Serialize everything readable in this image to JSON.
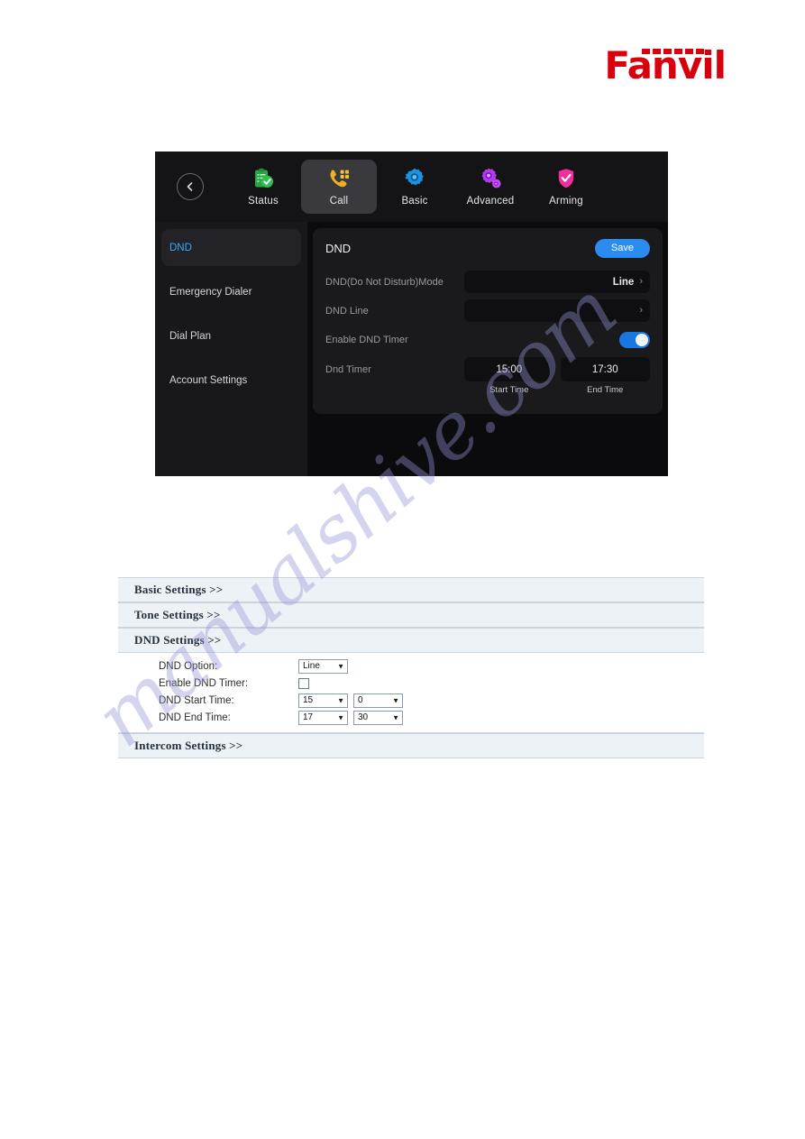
{
  "brand": {
    "name": "Fanvil",
    "color": "#d9000d"
  },
  "watermark": {
    "text": "manualshive.com"
  },
  "device": {
    "nav": {
      "back_icon": "chevron-left-icon",
      "items": [
        {
          "label": "Status",
          "icon": "clipboard-check-icon",
          "selected": false
        },
        {
          "label": "Call",
          "icon": "phone-keypad-icon",
          "selected": true
        },
        {
          "label": "Basic",
          "icon": "gear-icon",
          "selected": false
        },
        {
          "label": "Advanced",
          "icon": "double-gear-icon",
          "selected": false
        },
        {
          "label": "Arming",
          "icon": "shield-check-icon",
          "selected": false
        }
      ]
    },
    "sidebar": {
      "items": [
        {
          "label": "DND",
          "selected": true
        },
        {
          "label": "Emergency Dialer",
          "selected": false
        },
        {
          "label": "Dial Plan",
          "selected": false
        },
        {
          "label": "Account Settings",
          "selected": false
        }
      ]
    },
    "panel": {
      "title": "DND",
      "save_label": "Save",
      "rows": [
        {
          "label": "DND(Do Not Disturb)Mode",
          "value": "Line",
          "chevron": "›"
        },
        {
          "label": "DND Line",
          "value": "",
          "chevron": "›"
        }
      ],
      "toggle_row": {
        "label": "Enable DND Timer",
        "state": "on"
      },
      "timer_row": {
        "label": "Dnd Timer",
        "start_value": "15:00",
        "end_value": "17:30",
        "start_caption": "Start Time",
        "end_caption": "End Time"
      }
    },
    "accent": {
      "selected_text": "#3ea8f5",
      "save_bg": "#2b8cf0",
      "toggle_on": "#1877e0"
    }
  },
  "web": {
    "sections": [
      {
        "title": "Basic Settings >>"
      },
      {
        "title": "Tone Settings >>"
      },
      {
        "title": "DND Settings >>"
      },
      {
        "title": "Intercom Settings >>"
      }
    ],
    "dnd_form": {
      "option": {
        "label": "DND Option:",
        "value": "Line"
      },
      "enable_timer": {
        "label": "Enable DND Timer:",
        "checked": false
      },
      "start_time": {
        "label": "DND Start Time:",
        "hour": "15",
        "minute": "0"
      },
      "end_time": {
        "label": "DND End Time:",
        "hour": "17",
        "minute": "30"
      }
    }
  }
}
